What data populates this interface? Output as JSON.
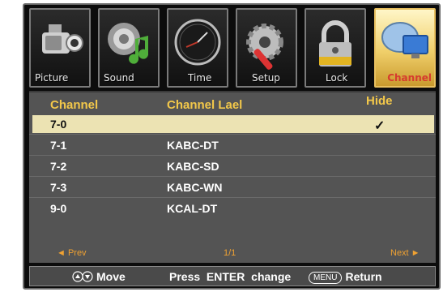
{
  "menu": {
    "tabs": [
      {
        "label": "Picture",
        "icon": "camcorder-icon",
        "active": false
      },
      {
        "label": "Sound",
        "icon": "speaker-note-icon",
        "active": false
      },
      {
        "label": "Time",
        "icon": "clock-icon",
        "active": false
      },
      {
        "label": "Setup",
        "icon": "gear-wrench-icon",
        "active": false
      },
      {
        "label": "Lock",
        "icon": "padlock-icon",
        "active": false
      },
      {
        "label": "Channel",
        "icon": "satellite-dish-icon",
        "active": true
      }
    ]
  },
  "table": {
    "headers": {
      "channel": "Channel",
      "label": "Channel Lael",
      "hide": "Hide"
    },
    "rows": [
      {
        "channel": "7-0",
        "label": "",
        "hide": "✓",
        "selected": true
      },
      {
        "channel": "7-1",
        "label": "KABC-DT",
        "hide": "",
        "selected": false
      },
      {
        "channel": "7-2",
        "label": "KABC-SD",
        "hide": "",
        "selected": false
      },
      {
        "channel": "7-3",
        "label": "KABC-WN",
        "hide": "",
        "selected": false
      },
      {
        "channel": "9-0",
        "label": "KCAL-DT",
        "hide": "",
        "selected": false
      }
    ]
  },
  "pager": {
    "prev": "◄ Prev",
    "page": "1/1",
    "next": "Next ►"
  },
  "help": {
    "move": "Move",
    "enter": "Press  ENTER  change",
    "menu_key": "MENU",
    "return": "Return"
  },
  "colors": {
    "header_gold": "#f3c84a",
    "selected_row": "#ece3b3",
    "pager_orange": "#f0a232",
    "panel_gray": "#545454"
  }
}
